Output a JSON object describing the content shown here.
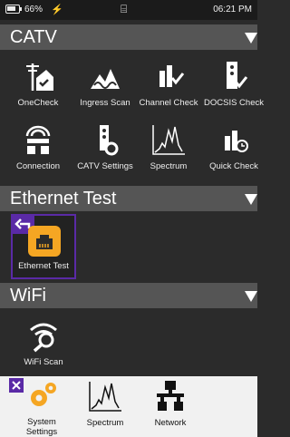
{
  "status": {
    "battery": "66%",
    "time": "06:21 PM"
  },
  "sections": [
    {
      "title": "CATV",
      "items": [
        {
          "label": "OneCheck",
          "icon": "onecheck-icon"
        },
        {
          "label": "Ingress Scan",
          "icon": "ingress-scan-icon"
        },
        {
          "label": "Channel Check",
          "icon": "channel-check-icon"
        },
        {
          "label": "DOCSIS Check",
          "icon": "docsis-check-icon"
        },
        {
          "label": "Connection",
          "icon": "connection-icon"
        },
        {
          "label": "CATV Settings",
          "icon": "catv-settings-icon"
        },
        {
          "label": "Spectrum",
          "icon": "spectrum-icon"
        },
        {
          "label": "Quick Check",
          "icon": "quick-check-icon"
        }
      ]
    },
    {
      "title": "Ethernet Test",
      "items": [
        {
          "label": "Ethernet Test",
          "icon": "ethernet-icon"
        }
      ]
    },
    {
      "title": "WiFi",
      "items": [
        {
          "label": "WiFi Scan",
          "icon": "wifi-scan-icon"
        }
      ]
    }
  ],
  "favorites": [
    {
      "label": "System Settings",
      "icon": "gears-icon"
    },
    {
      "label": "Spectrum",
      "icon": "spectrum-icon"
    },
    {
      "label": "Network",
      "icon": "network-icon"
    }
  ],
  "colors": {
    "accent_orange": "#f5a623",
    "selection_purple": "#5a2aa6",
    "header_gray": "#555555"
  }
}
